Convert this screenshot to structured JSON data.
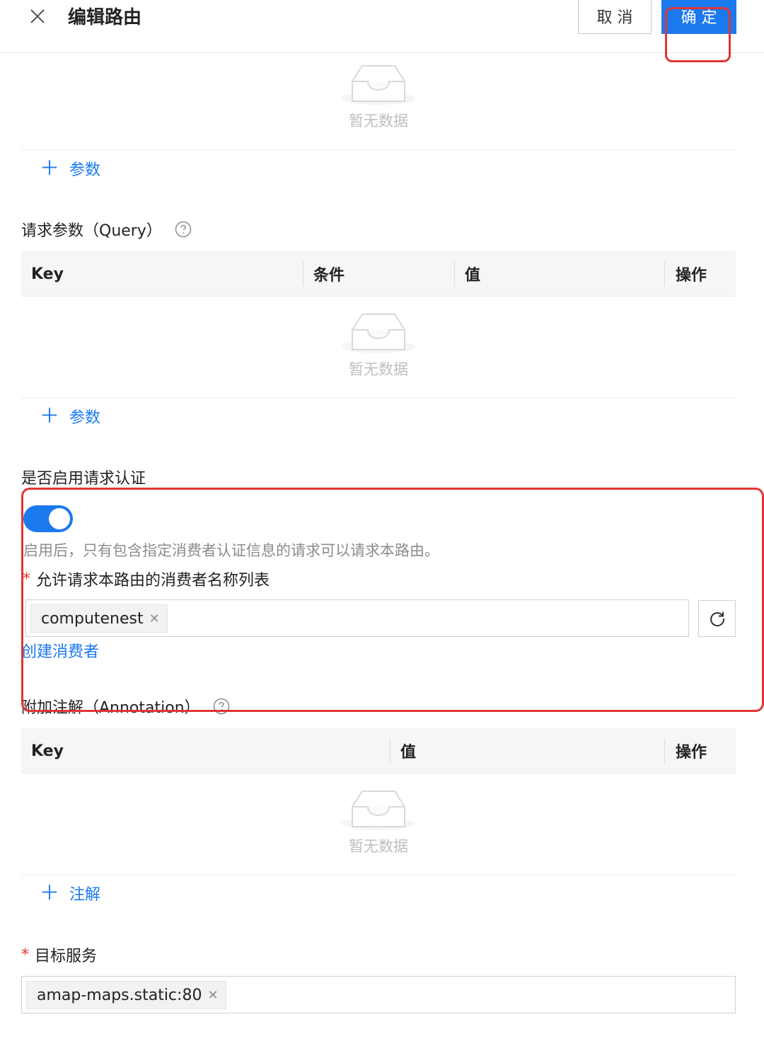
{
  "header": {
    "title": "编辑路由",
    "cancel_label": "取 消",
    "ok_label": "确 定"
  },
  "empty_text": "暂无数据",
  "add_param_label": "参数",
  "add_annotation_label": "注解",
  "query": {
    "label": "请求参数（Query）",
    "columns": [
      "Key",
      "条件",
      "值",
      "操作"
    ]
  },
  "auth": {
    "label": "是否启用请求认证",
    "enabled": true,
    "description": "启用后，只有包含指定消费者认证信息的请求可以请求本路由。",
    "consumers_label": "允许请求本路由的消费者名称列表",
    "consumers": [
      "computenest"
    ],
    "create_consumer_label": "创建消费者"
  },
  "annotation": {
    "label": "附加注解（Annotation）",
    "columns": [
      "Key",
      "值",
      "操作"
    ]
  },
  "target": {
    "label": "目标服务",
    "services": [
      "amap-maps.static:80"
    ]
  },
  "icons": {
    "close": "close-icon",
    "help": "help-icon",
    "empty": "empty-inbox-icon",
    "refresh": "refresh-icon",
    "remove": "remove-tag-icon"
  },
  "colors": {
    "primary": "#1b79ee",
    "required": "#e23434",
    "annotation_box": "#e23434"
  }
}
